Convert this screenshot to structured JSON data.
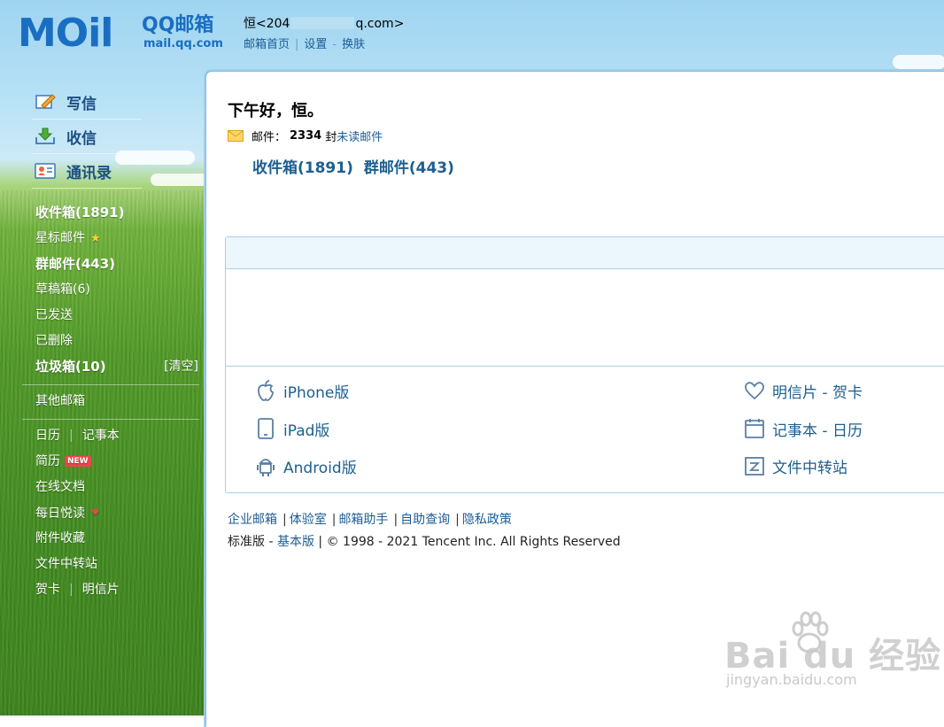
{
  "header": {
    "logo_mail": "MOil",
    "logo_qq": "QQ邮箱",
    "logo_domain": "mail.qq.com",
    "user_prefix": "恒<204",
    "user_suffix": "q.com>",
    "links": [
      "邮箱首页",
      "设置",
      "换肤"
    ]
  },
  "sidebar": {
    "main": [
      {
        "label": "写信",
        "icon": "write-icon"
      },
      {
        "label": "收信",
        "icon": "inbox-download-icon"
      },
      {
        "label": "通讯录",
        "icon": "contacts-icon"
      }
    ],
    "folders": {
      "inbox": "收件箱(1891)",
      "starred": "星标邮件",
      "group": "群邮件(443)",
      "drafts": "草稿箱(6)",
      "sent": "已发送",
      "deleted": "已删除",
      "spam": "垃圾箱(10)",
      "clear": "[清空]"
    },
    "other": "其他邮箱",
    "tools": {
      "calendar": "日历",
      "notebook": "记事本",
      "resume": "简历",
      "new_badge": "NEW",
      "docs": "在线文档",
      "daily": "每日悦读",
      "attachments": "附件收藏",
      "transfer": "文件中转站",
      "card": "贺卡",
      "postcard": "明信片"
    }
  },
  "main": {
    "greeting": "下午好，恒。",
    "mail_label": "邮件：",
    "mail_count": "2334",
    "mail_unit": "封",
    "unread_link": "未读邮件",
    "quick_inbox": "收件箱(1891)",
    "quick_group": "群邮件(443)",
    "apps": {
      "iphone": "iPhone版",
      "ipad": "iPad版",
      "android": "Android版",
      "postcard": "明信片 - 贺卡",
      "notebook": "记事本 - 日历",
      "transfer": "文件中转站"
    },
    "footer_links": [
      "企业邮箱",
      "体验室",
      "邮箱助手",
      "自助查询",
      "隐私政策"
    ],
    "footer_std": "标准版",
    "footer_dash": "-",
    "footer_basic": "基本版",
    "copyright": "| © 1998 - 2021 Tencent Inc. All Rights Reserved"
  },
  "watermark": {
    "text": "Bai du 经验",
    "sub": "jingyan.baidu.com"
  },
  "colors": {
    "link": "#1c5c95",
    "brand": "#1a6ec2",
    "badge": "#e8474a"
  }
}
